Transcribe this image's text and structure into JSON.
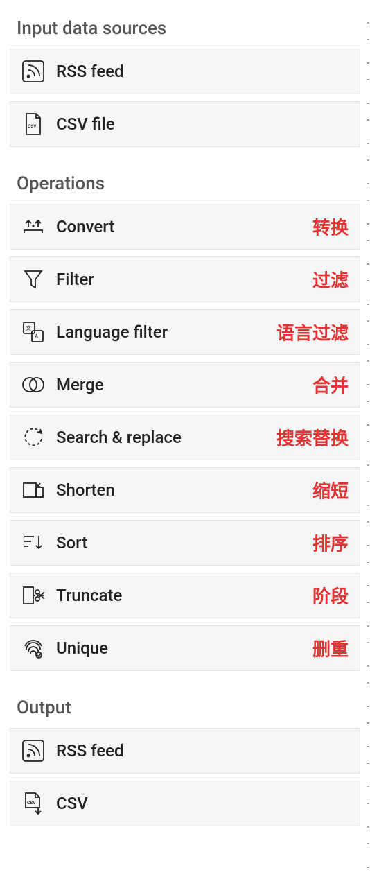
{
  "sections": {
    "input": {
      "title": "Input data sources"
    },
    "operations": {
      "title": "Operations"
    },
    "output": {
      "title": "Output"
    }
  },
  "input": {
    "rss": {
      "label": "RSS feed"
    },
    "csv": {
      "label": "CSV file"
    }
  },
  "operations": {
    "convert": {
      "label": "Convert",
      "annot": "转换"
    },
    "filter": {
      "label": "Filter",
      "annot": "过滤"
    },
    "language_filter": {
      "label": "Language filter",
      "annot": "语言过滤"
    },
    "merge": {
      "label": "Merge",
      "annot": "合并"
    },
    "search_replace": {
      "label": "Search & replace",
      "annot": "搜索替换"
    },
    "shorten": {
      "label": "Shorten",
      "annot": "缩短"
    },
    "sort": {
      "label": "Sort",
      "annot": "排序"
    },
    "truncate": {
      "label": "Truncate",
      "annot": "阶段"
    },
    "unique": {
      "label": "Unique",
      "annot": "删重"
    }
  },
  "output": {
    "rss": {
      "label": "RSS feed"
    },
    "csv": {
      "label": "CSV"
    }
  }
}
